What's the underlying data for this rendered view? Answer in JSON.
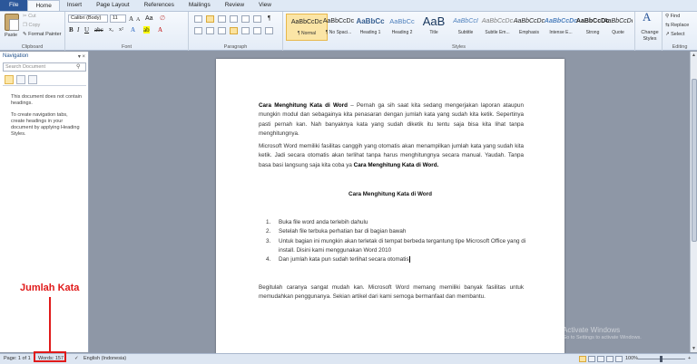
{
  "tabs": [
    "File",
    "Home",
    "Insert",
    "Page Layout",
    "References",
    "Mailings",
    "Review",
    "View"
  ],
  "clipboard": {
    "paste": "Paste",
    "cut": "Cut",
    "copy": "Copy",
    "format_painter": "Format Painter",
    "label": "Clipboard"
  },
  "font": {
    "name": "Calibri (Body)",
    "size": "11",
    "label": "Font"
  },
  "paragraph": {
    "label": "Paragraph"
  },
  "styles": {
    "label": "Styles",
    "items": [
      {
        "sample": "AaBbCcDc",
        "name": "¶ Normal"
      },
      {
        "sample": "AaBbCcDc",
        "name": "¶ No Spaci..."
      },
      {
        "sample": "AaBbCc",
        "name": "Heading 1"
      },
      {
        "sample": "AaBbCc",
        "name": "Heading 2"
      },
      {
        "sample": "AaB",
        "name": "Title"
      },
      {
        "sample": "AaBbCcI",
        "name": "Subtitle"
      },
      {
        "sample": "AaBbCcDc",
        "name": "Subtle Em..."
      },
      {
        "sample": "AaBbCcDc",
        "name": "Emphasis"
      },
      {
        "sample": "AaBbCcDc",
        "name": "Intense E..."
      },
      {
        "sample": "AaBbCcDc",
        "name": "Strong"
      },
      {
        "sample": "AaBbCcDc",
        "name": "Quote"
      }
    ],
    "change_styles": "Change Styles"
  },
  "editing": {
    "find": "Find",
    "replace": "Replace",
    "select": "Select",
    "label": "Editing"
  },
  "navigation": {
    "title": "Navigation",
    "search_placeholder": "Search Document",
    "message1": "This document does not contain headings.",
    "message2": "To create navigation tabs, create headings in your document by applying Heading Styles."
  },
  "document": {
    "p1_bold": "Cara Menghitung Kata di Word",
    "p1_rest": " – Pernah ga sih saat kita sedang mengerjakan laporan ataupun mungkin modul dan sebagainya kita penasaran dengan jumlah kata yang sudah kita ketik. Sepertinya pasti pernah kan. Nah banyaknya kata yang sudah diketik itu tentu saja bisa kita lihat tanpa menghitungnya.",
    "p2_text": "Microsoft Word memiliki fasilitas canggih yang otomatis akan menampilkan jumlah kata yang sudah kita ketik. Jadi secara otomatis akan terlihat tanpa harus menghitungnya secara manual. Yaudah. Tanpa basa basi langsung saja kita coba ya ",
    "p2_bold": "Cara Menghitung Kata di Word.",
    "heading": "Cara Menghitung Kata di Word",
    "steps": [
      "Buka file word anda terlebih dahulu",
      "Setelah file terbuka perhatian bar di bagian bawah",
      "Untuk bagian ini mungkin akan terletak di tempat berbeda tergantung tipe Microsoft Office yang di install. Disini kami menggunakan Word 2010",
      "Dan jumlah kata pun sudah terlihat secara otomatis"
    ],
    "closing": "Begitulah caranya sangat mudah kan. Microsoft Word memang memiliki banyak fasilitas untuk memudahkan penggunanya. Sekian artikel dari kami semoga bermanfaat dan membantu."
  },
  "watermark": {
    "line1": "Activate Windows",
    "line2": "Go to Settings to activate Windows."
  },
  "annotation": "Jumlah Kata",
  "status": {
    "page": "Page: 1 of 1",
    "words": "Words: 157",
    "language": "English (Indonesia)",
    "zoom": "100%"
  }
}
